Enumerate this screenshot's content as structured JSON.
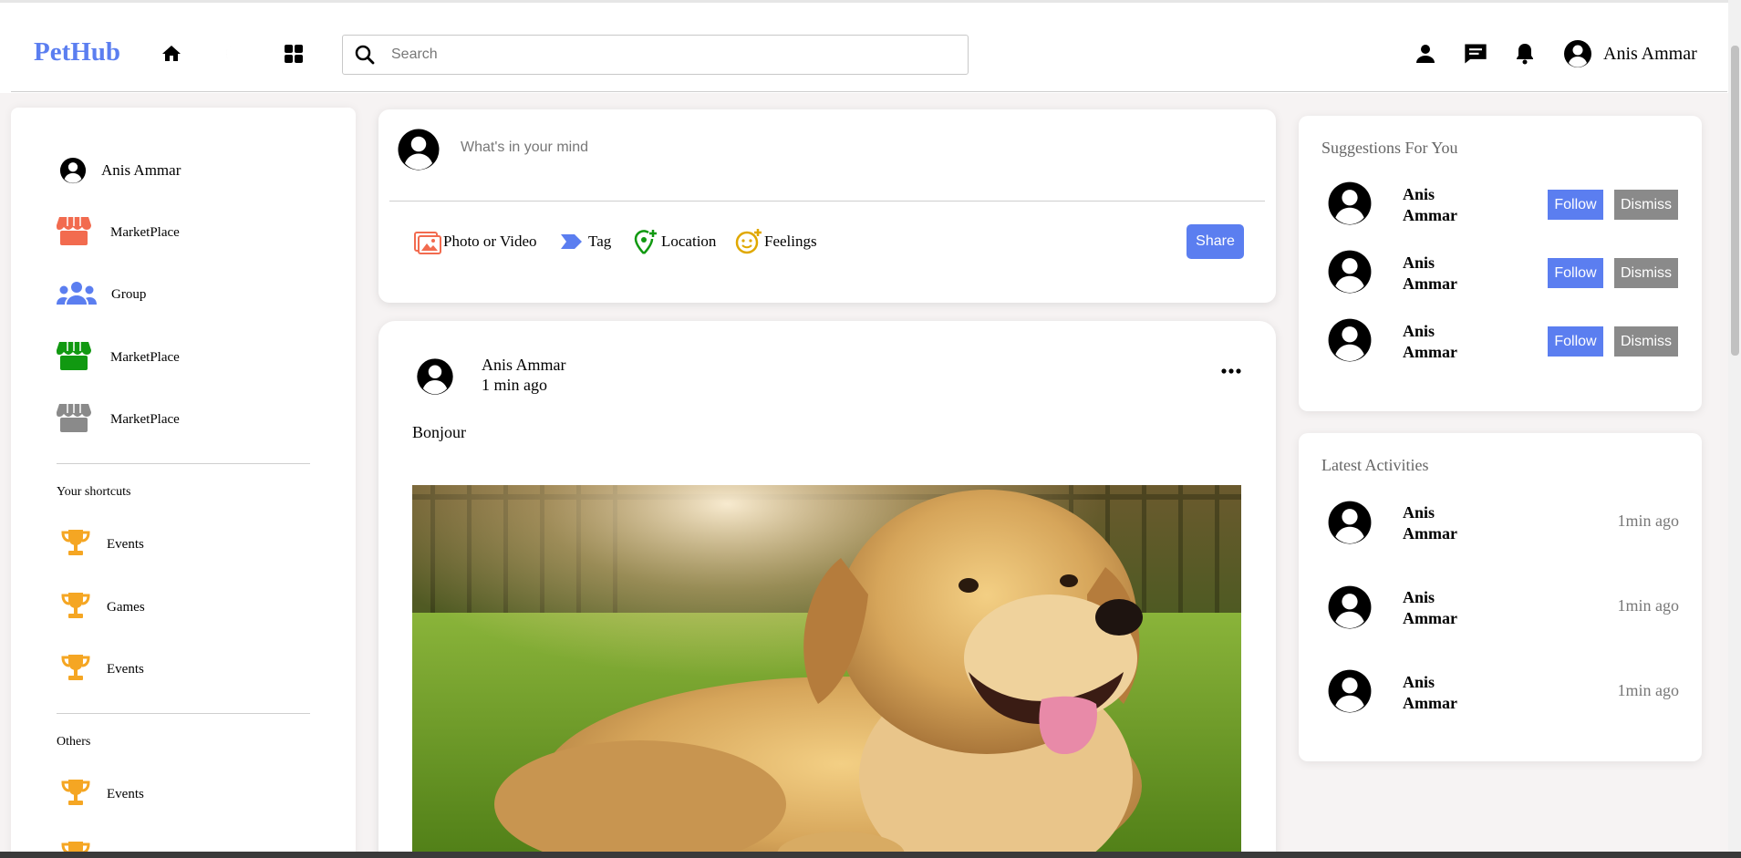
{
  "header": {
    "logo": "PetHub",
    "search_placeholder": "Search",
    "user_name": "Anis Ammar",
    "nav_icons": [
      "home-icon",
      "moon-icon",
      "grid-icon"
    ],
    "right_icons": [
      "person-icon",
      "message-icon",
      "bell-icon"
    ]
  },
  "sidebar": {
    "user": {
      "label": "Anis Ammar",
      "icon": "avatar-icon"
    },
    "items": [
      {
        "label": "MarketPlace",
        "icon": "store-icon",
        "color": "#f26b4f"
      },
      {
        "label": "Group",
        "icon": "group-icon",
        "color": "#5b7ef0"
      },
      {
        "label": "MarketPlace",
        "icon": "store-icon",
        "color": "#119911"
      },
      {
        "label": "MarketPlace",
        "icon": "store-icon",
        "color": "#8a8a8a"
      }
    ],
    "shortcuts_heading": "Your shortcuts",
    "shortcuts": [
      {
        "label": "Events",
        "icon": "trophy-icon"
      },
      {
        "label": "Games",
        "icon": "trophy-icon"
      },
      {
        "label": "Events",
        "icon": "trophy-icon"
      }
    ],
    "others_heading": "Others",
    "others": [
      {
        "label": "Events",
        "icon": "trophy-icon"
      }
    ],
    "trophy_color": "#f5a623"
  },
  "composer": {
    "placeholder": "What's in your mind",
    "actions": [
      {
        "label": "Photo or Video",
        "icon": "photo-icon",
        "color": "#f26b4f"
      },
      {
        "label": "Tag",
        "icon": "tag-icon",
        "color": "#5b7ef0"
      },
      {
        "label": "Location",
        "icon": "location-icon",
        "color": "#119911"
      },
      {
        "label": "Feelings",
        "icon": "smiley-icon",
        "color": "#e0a800"
      }
    ],
    "share_label": "Share"
  },
  "post": {
    "author": "Anis Ammar",
    "time": "1 min ago",
    "text": "Bonjour",
    "image": "golden-retriever-photo"
  },
  "suggestions": {
    "title": "Suggestions For You",
    "follow_label": "Follow",
    "dismiss_label": "Dismiss",
    "users": [
      {
        "first": "Anis",
        "last": "Ammar"
      },
      {
        "first": "Anis",
        "last": "Ammar"
      },
      {
        "first": "Anis",
        "last": "Ammar"
      }
    ]
  },
  "activities": {
    "title": "Latest Activities",
    "items": [
      {
        "first": "Anis",
        "last": "Ammar",
        "time": "1min ago"
      },
      {
        "first": "Anis",
        "last": "Ammar",
        "time": "1min ago"
      },
      {
        "first": "Anis",
        "last": "Ammar",
        "time": "1min ago"
      }
    ]
  },
  "colors": {
    "accent": "#5b7ef0",
    "dismiss": "#8a8a8a"
  }
}
